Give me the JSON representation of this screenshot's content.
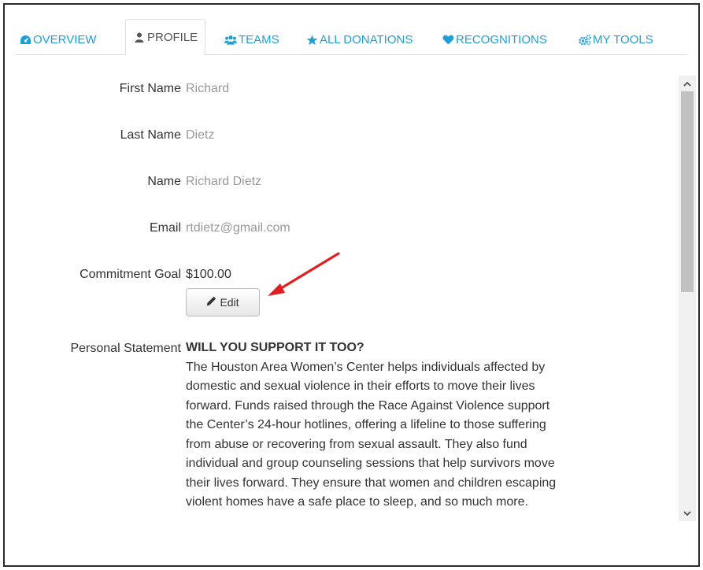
{
  "tabs": [
    {
      "label": "OVERVIEW",
      "icon": "dashboard-icon"
    },
    {
      "label": "PROFILE",
      "icon": "user-icon"
    },
    {
      "label": "TEAMS",
      "icon": "users-icon"
    },
    {
      "label": "ALL DONATIONS",
      "icon": "star-icon"
    },
    {
      "label": "RECOGNITIONS",
      "icon": "heart-icon"
    },
    {
      "label": "MY TOOLS",
      "icon": "cogs-icon"
    }
  ],
  "active_tab": "PROFILE",
  "profile": {
    "first_name": {
      "label": "First Name",
      "value": "Richard"
    },
    "last_name": {
      "label": "Last Name",
      "value": "Dietz"
    },
    "name": {
      "label": "Name",
      "value": "Richard Dietz"
    },
    "email": {
      "label": "Email",
      "value": "rtdietz@gmail.com"
    },
    "commitment_goal": {
      "label": "Commitment Goal",
      "value": "$100.00",
      "edit_label": "Edit"
    },
    "personal_statement": {
      "label": "Personal Statement",
      "title": "WILL YOU SUPPORT IT TOO?",
      "lines": [
        "The Houston Area Women’s Center helps individuals affected by",
        "domestic and sexual violence in their efforts to move their lives",
        "forward.  Funds raised through the Race Against Violence support",
        "the Center’s 24-hour hotlines, offering a lifeline to those suffering",
        "from abuse or recovering from sexual assault. They also fund",
        "individual and group counseling sessions that help survivors move",
        "their lives forward. They ensure that women and children escaping",
        "violent homes have a safe place to sleep, and so much more."
      ]
    }
  },
  "colors": {
    "link": "#1e9fd8",
    "annotation_arrow": "#e02020"
  }
}
